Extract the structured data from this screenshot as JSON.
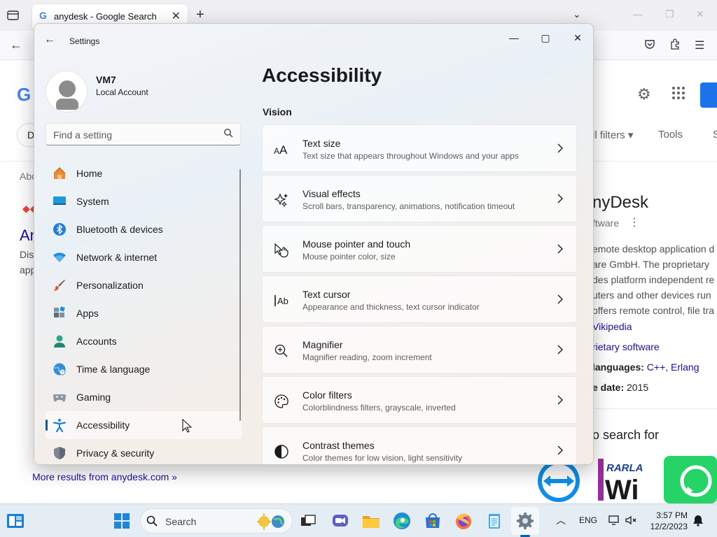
{
  "browser": {
    "tab_title": "anydesk - Google Search",
    "new_tab": "+",
    "close_tab": "✕"
  },
  "google": {
    "chip_label": "D",
    "filters": "ll filters",
    "tools": "Tools",
    "s": "S",
    "about": "Abo",
    "result_title": "An",
    "result_desc_1": "Dis",
    "result_desc_2": "app",
    "more_results": "More results from anydesk.com »",
    "kp_title": "nyDesk",
    "kp_subtitle": "ftware",
    "kp_desc": [
      "emote desktop application d",
      "are GmbH. The proprietary",
      "des platform independent re",
      "uters and other devices run",
      "offers remote control, file tra"
    ],
    "kp_wiki": "Vikipedia",
    "kp_software": "rietary software",
    "kp_lang_label": " languages:",
    "kp_lang_value": " C++, Erlang",
    "kp_date_label": "e date:",
    "kp_date_value": " 2015",
    "kp_also": "o search for"
  },
  "settings": {
    "window_title": "Settings",
    "user_name": "VM7",
    "account_type": "Local Account",
    "search_placeholder": "Find a setting",
    "nav": [
      {
        "label": "Home"
      },
      {
        "label": "System"
      },
      {
        "label": "Bluetooth & devices"
      },
      {
        "label": "Network & internet"
      },
      {
        "label": "Personalization"
      },
      {
        "label": "Apps"
      },
      {
        "label": "Accounts"
      },
      {
        "label": "Time & language"
      },
      {
        "label": "Gaming"
      },
      {
        "label": "Accessibility",
        "selected": true
      },
      {
        "label": "Privacy & security"
      }
    ],
    "page_title": "Accessibility",
    "section_title": "Vision",
    "cards": [
      {
        "title": "Text size",
        "desc": "Text size that appears throughout Windows and your apps",
        "icon": "text-size-icon"
      },
      {
        "title": "Visual effects",
        "desc": "Scroll bars, transparency, animations, notification timeout",
        "icon": "visual-effects-icon"
      },
      {
        "title": "Mouse pointer and touch",
        "desc": "Mouse pointer color, size",
        "icon": "mouse-pointer-icon"
      },
      {
        "title": "Text cursor",
        "desc": "Appearance and thickness, text cursor indicator",
        "icon": "text-cursor-icon"
      },
      {
        "title": "Magnifier",
        "desc": "Magnifier reading, zoom increment",
        "icon": "magnifier-icon"
      },
      {
        "title": "Color filters",
        "desc": "Colorblindness filters, grayscale, inverted",
        "icon": "color-filters-icon"
      },
      {
        "title": "Contrast themes",
        "desc": "Color themes for low vision, light sensitivity",
        "icon": "contrast-themes-icon"
      }
    ]
  },
  "taskbar": {
    "search_label": "Search",
    "language": "ENG",
    "time": "3:57 PM",
    "date": "12/2/2023"
  },
  "colors": {
    "accent": "#005fb8",
    "link": "#1a0dab"
  }
}
